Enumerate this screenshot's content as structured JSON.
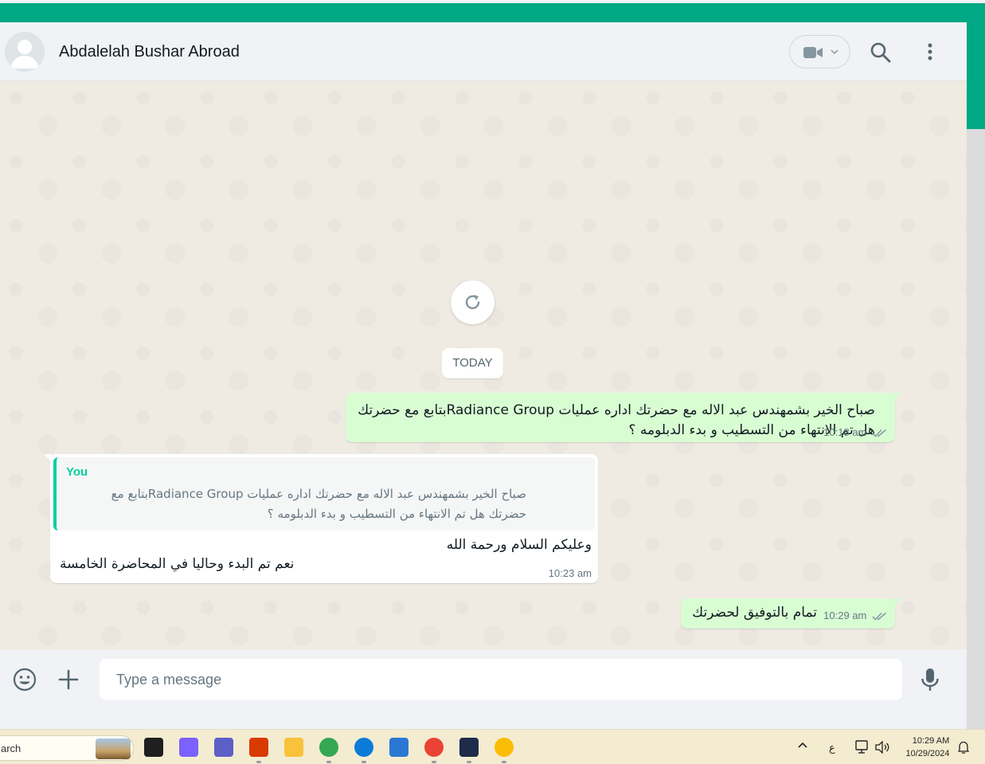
{
  "header": {
    "contact_name": "Abdalelah Bushar Abroad"
  },
  "chat": {
    "date_divider": "TODAY",
    "messages": [
      {
        "direction": "outgoing",
        "text": "صباح الخير بشمهندس عبد الاله مع  حضرتك اداره عمليات Radiance Groupبتابع مع حضرتك هل تم الانتهاء من التسطيب و بدء الدبلومه ؟",
        "time": "10:18 am",
        "status": "read"
      },
      {
        "direction": "incoming",
        "quoted_author": "You",
        "quoted_text": "صباح الخير بشمهندس عبد الاله مع  حضرتك اداره عمليات Radiance Groupبتابع مع حضرتك هل تم الانتهاء من التسطيب و بدء الدبلومه ؟",
        "line1": "وعليكم السلام ورحمة الله",
        "line2": "نعم تم البدء وحاليا في المحاضرة الخامسة",
        "time": "10:23 am"
      },
      {
        "direction": "outgoing",
        "text": "تمام بالتوفيق لحضرتك",
        "time": "10:29 am",
        "status": "read"
      }
    ]
  },
  "composer": {
    "placeholder": "Type a message",
    "value": ""
  },
  "taskbar": {
    "search_text": "arch",
    "language": "ع",
    "time": "10:29 AM",
    "date": "10/29/2024",
    "apps": [
      {
        "name": "task-view",
        "color": "#1f1f1f"
      },
      {
        "name": "copilot",
        "color": "#7b61ff"
      },
      {
        "name": "teams",
        "color": "#5b5fc7"
      },
      {
        "name": "snipping-tool",
        "color": "#d83b01"
      },
      {
        "name": "file-explorer",
        "color": "#f8c23a"
      },
      {
        "name": "chrome-profile",
        "color": "#34a853"
      },
      {
        "name": "edge",
        "color": "#0c7bd8"
      },
      {
        "name": "notepad",
        "color": "#2b78d4"
      },
      {
        "name": "chrome",
        "color": "#ea4335"
      },
      {
        "name": "equalizer-app",
        "color": "#1e2b4a"
      },
      {
        "name": "chrome-badge",
        "color": "#fbbc05"
      }
    ]
  },
  "colors": {
    "accent": "#00a884",
    "outgoing_bubble": "#d9fdd3",
    "incoming_bubble": "#ffffff",
    "chat_background": "#efeae2",
    "read_ticks": "#8696a0"
  }
}
